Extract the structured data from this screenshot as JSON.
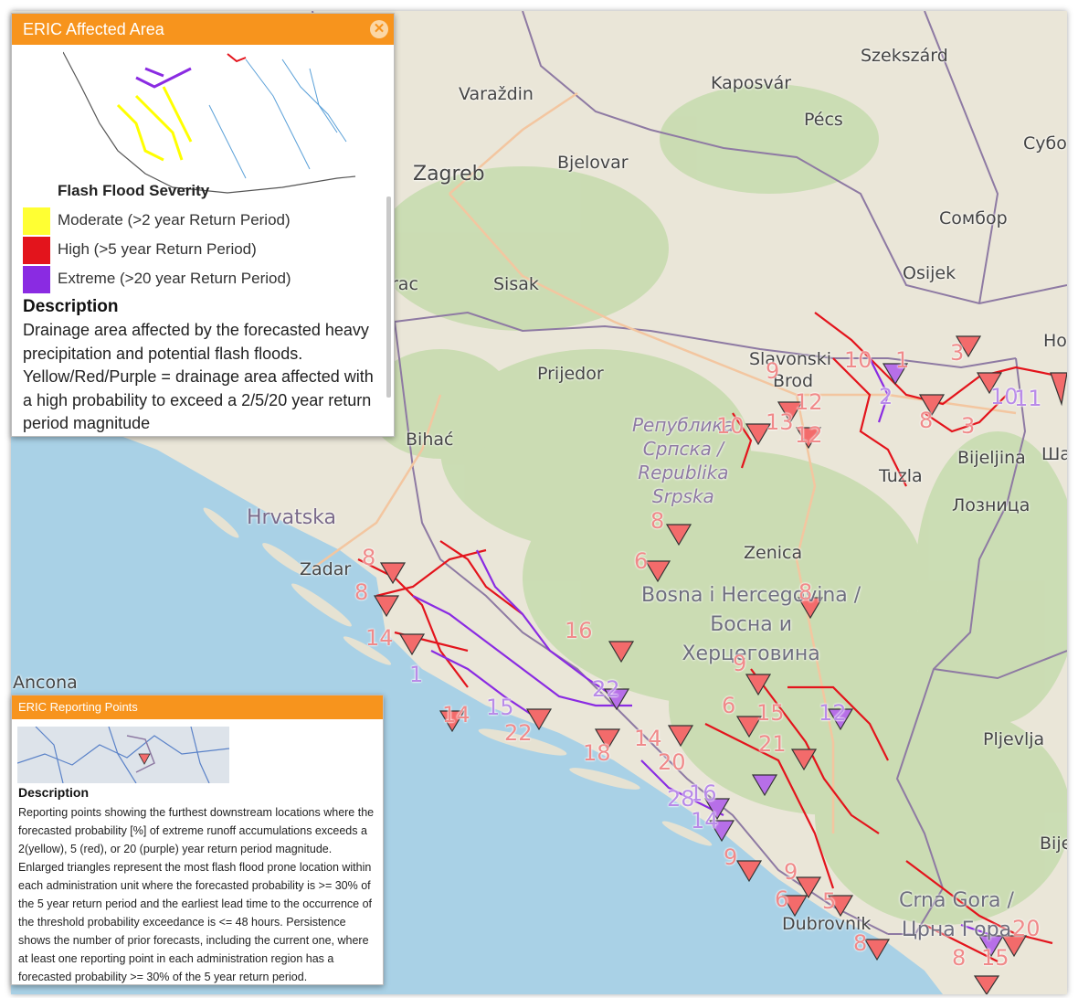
{
  "map": {
    "colors": {
      "land": "#eae6d8",
      "forest": "#c8dcb0",
      "sea": "#a9d1e6",
      "border": "#8e7aa3",
      "flood_red": "#e3141c",
      "flood_purple": "#8a2be2"
    },
    "countries": [
      "Hrvatska",
      "Bosna i Hercegovina /",
      "Босна и",
      "Херцеговина",
      "Crna Gora /",
      "Црна Гора"
    ],
    "republika_srpska": [
      "Република",
      "Српска /",
      "Republika",
      "Srpska"
    ],
    "cities": [
      "Zagreb",
      "Varaždin",
      "Kaposvár",
      "Szekszárd",
      "Pécs",
      "Bjelovar",
      "Сомбор",
      "Субо",
      "Osijek",
      "Sisak",
      "Prijedor",
      "Slavonski",
      "Brod",
      "Bihać",
      "Tuzla",
      "Bijeljina",
      "Ша",
      "Лозница",
      "Zadar",
      "Zenica",
      "Ancona",
      "Pljevlja",
      "Dubrovnik",
      "Bije",
      "Но",
      "rac"
    ],
    "marker_labels": [
      "9",
      "10",
      "1",
      "3",
      "2",
      "12",
      "10",
      "11",
      "13",
      "12",
      "8",
      "3",
      "8",
      "10",
      "13",
      "12",
      "6",
      "7",
      "8",
      "8",
      "1",
      "14",
      "1",
      "6",
      "1",
      "16",
      "22",
      "8",
      "14",
      "15",
      "22",
      "18",
      "14",
      "2",
      "15",
      "9",
      "6",
      "15",
      "1",
      "20",
      "21",
      "12",
      "5",
      "4",
      "16",
      "28",
      "14",
      "9",
      "9",
      "6",
      "5",
      "8",
      "6",
      "8",
      "15",
      "20"
    ]
  },
  "panel_affected": {
    "title": "ERIC Affected Area",
    "close_icon": "close-icon",
    "legend_title": "Flash Flood Severity",
    "legend": [
      {
        "color": "#ffff33",
        "label": "Moderate  (>2 year Return Period)"
      },
      {
        "color": "#e3141c",
        "label": "High (>5 year Return Period)"
      },
      {
        "color": "#8a2be2",
        "label": "Extreme (>20 year Return Period)"
      }
    ],
    "description_title": "Description",
    "description": "Drainage area affected by the forecasted heavy precipitation and potential flash floods. Yellow/Red/Purple = drainage area affected with a high probability to exceed a 2/5/20 year return period magnitude"
  },
  "panel_reporting": {
    "title": "ERIC Reporting Points",
    "description_title": "Description",
    "description": "Reporting points showing the furthest downstream locations where the forecasted probability [%] of extreme runoff accumulations exceeds a 2(yellow), 5 (red), or 20 (purple) year return period magnitude. Enlarged triangles represent the most flash flood prone location within each administration unit where the forecasted probability is >= 30% of the 5 year return period and the earliest lead time to the occurrence of the threshold probability exceedance is <= 48 hours. Persistence shows the number of prior forecasts, including the current one, where at least one reporting point in each administration region has a forecasted probability >= 30% of the 5 year return period."
  }
}
